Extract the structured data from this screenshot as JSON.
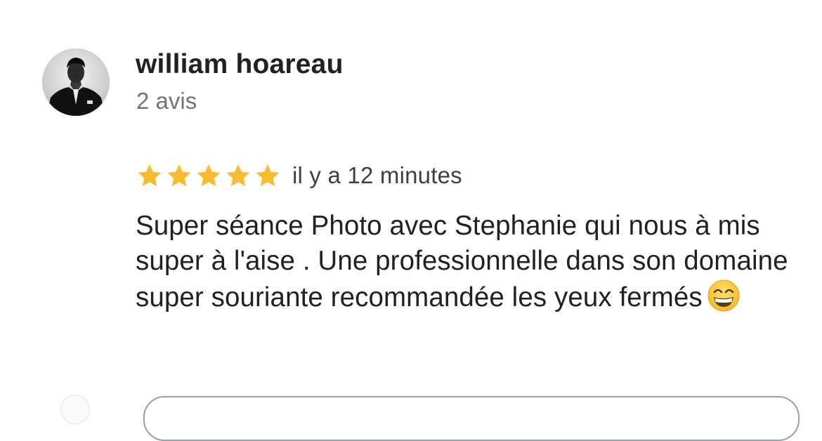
{
  "review": {
    "reviewer": {
      "name": "william hoareau",
      "review_count": "2 avis"
    },
    "rating": {
      "stars": 5,
      "max_stars": 5,
      "star_color": "#F6BB2F"
    },
    "time_ago": "il y a 12 minutes",
    "text": "Super séance Photo avec Stephanie qui nous à mis super à l'aise . Une professionnelle dans son domaine super souriante recommandée les yeux fermés",
    "text_emoji": "grinning-face-with-smiling-eyes-emoji"
  },
  "colors": {
    "name": "#202124",
    "meta": "#70757A",
    "body_text": "#202124",
    "star": "#F6BB2F"
  }
}
